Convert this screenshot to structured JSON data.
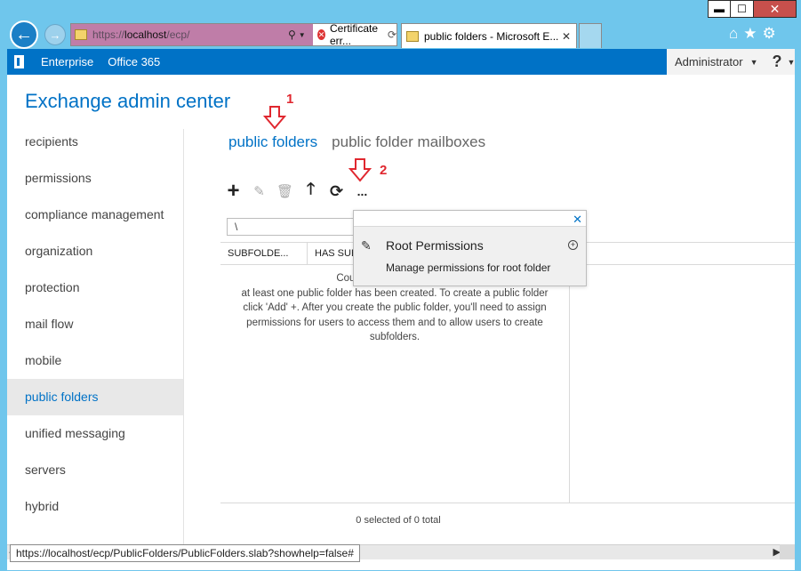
{
  "window": {
    "minimize_label": "▬",
    "maximize_label": "☐",
    "close_label": "✕"
  },
  "browser": {
    "address": {
      "protocol": "https://",
      "host": "localhost",
      "path": "/ecp/",
      "search_icon": "search-icon",
      "cert_error": "Certificate err..."
    },
    "tab": {
      "title": "public folders - Microsoft E..."
    },
    "status_url": "https://localhost/ecp/PublicFolders/PublicFolders.slab?showhelp=false#"
  },
  "topbar": {
    "enterprise": "Enterprise",
    "office365": "Office 365",
    "admin": "Administrator",
    "help": "?"
  },
  "app_title": "Exchange admin center",
  "nav": {
    "items": [
      {
        "label": "recipients"
      },
      {
        "label": "permissions"
      },
      {
        "label": "compliance management"
      },
      {
        "label": "organization"
      },
      {
        "label": "protection"
      },
      {
        "label": "mail flow"
      },
      {
        "label": "mobile"
      },
      {
        "label": "public folders",
        "active": true
      },
      {
        "label": "unified messaging"
      },
      {
        "label": "servers"
      },
      {
        "label": "hybrid"
      }
    ]
  },
  "subtabs": {
    "active": "public folders",
    "other": "public folder mailboxes"
  },
  "toolbar": {
    "add": "+",
    "edit": "✎",
    "delete": "🗑",
    "up": "🡑",
    "refresh": "⟳",
    "more": "..."
  },
  "path_field": "\\",
  "grid": {
    "columns": [
      "SUBFOLDE...",
      "HAS SUB"
    ],
    "empty_lines": [
      "Couldn't find any public fo",
      "at least one public folder has been created. To create a public folder",
      "click 'Add' +. After you create the public folder, you'll need to assign",
      "permissions for users to access them and to allow users to create",
      "subfolders."
    ],
    "footer": "0 selected of 0 total"
  },
  "flyout": {
    "close": "✕",
    "item_title": "Root Permissions",
    "item_desc": "Manage permissions for root folder",
    "item_plus": "+"
  },
  "annotations": {
    "one": "1",
    "two": "2",
    "color": "#e0272f"
  },
  "colors": {
    "accent": "#0072c6",
    "chrome": "#6fc6ec"
  }
}
